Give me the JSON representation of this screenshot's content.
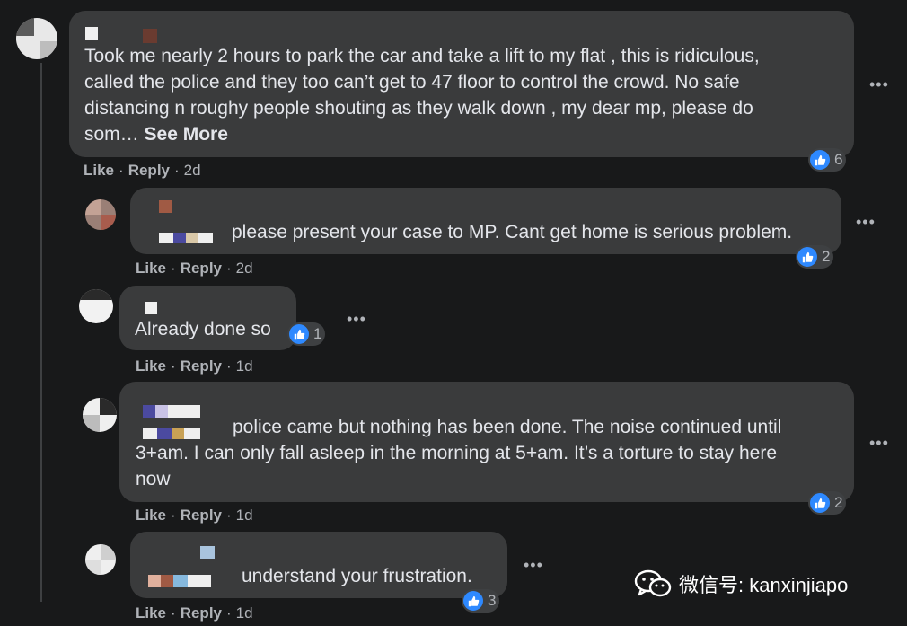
{
  "comments": [
    {
      "text": "Took me nearly 2 hours to park the car and take a lift to my flat , this is ridiculous,\ncalled the police and they too can’t get to 47 floor to control the crowd. No safe\ndistancing n roughy people shouting as they walk down , my dear mp, please do\nsom… ",
      "see_more": "See More",
      "reactions": "6",
      "like": "Like",
      "reply": "Reply",
      "time": "2d",
      "more": "•••"
    },
    {
      "text": "please present your case to MP. Cant get home is serious problem.",
      "reactions": "2",
      "like": "Like",
      "reply": "Reply",
      "time": "2d",
      "more": "•••"
    },
    {
      "text": "Already done so",
      "reactions": "1",
      "like": "Like",
      "reply": "Reply",
      "time": "1d",
      "more": "•••"
    },
    {
      "text": "police came but nothing has been done. The noise continued until\n3+am. I can only fall asleep in the morning at 5+am. It’s a torture to stay here\nnow",
      "reactions": "2",
      "like": "Like",
      "reply": "Reply",
      "time": "1d",
      "more": "•••"
    },
    {
      "text": "understand your frustration.",
      "reactions": "3",
      "like": "Like",
      "reply": "Reply",
      "time": "1d",
      "more": "•••"
    }
  ],
  "watermark": {
    "icon": "wechat-icon",
    "label": "微信号: kanxinjiapo"
  },
  "colors": {
    "background": "#18191a",
    "bubble": "#3a3b3c",
    "like_blue": "#2e89ff",
    "muted_text": "#b0b3b8"
  }
}
